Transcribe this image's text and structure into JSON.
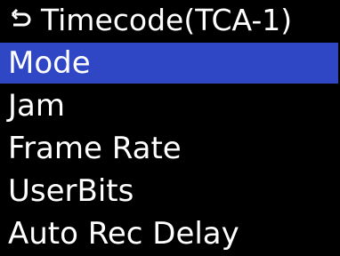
{
  "header": {
    "title": "Timecode(TCA-1)",
    "back_icon": "return-arrow-icon"
  },
  "menu": {
    "selected_index": 0,
    "items": [
      {
        "label": "Mode"
      },
      {
        "label": "Jam"
      },
      {
        "label": "Frame Rate"
      },
      {
        "label": "UserBits"
      },
      {
        "label": "Auto Rec Delay"
      }
    ]
  },
  "colors": {
    "background": "#000000",
    "text": "#ffffff",
    "selection": "#2f47c4"
  }
}
